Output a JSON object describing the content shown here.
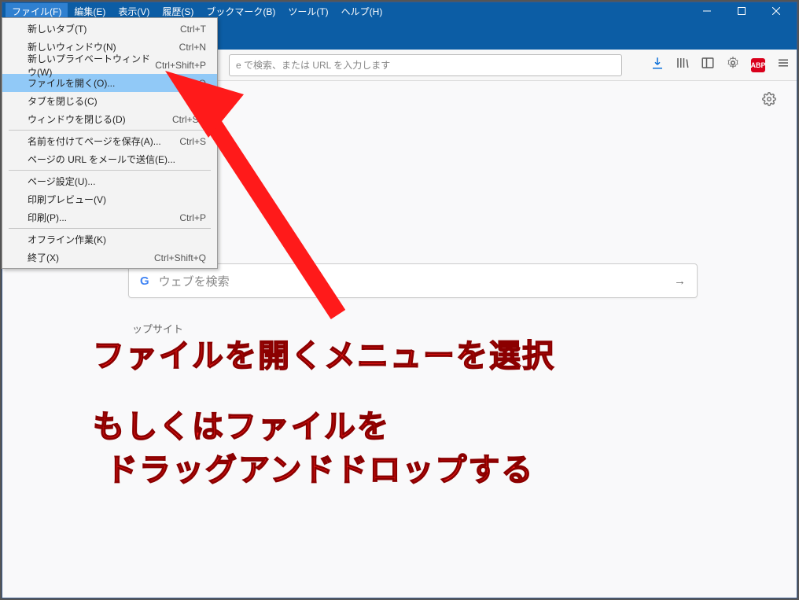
{
  "menubar": {
    "file": "ファイル(F)",
    "edit": "編集(E)",
    "view": "表示(V)",
    "history": "履歴(S)",
    "bookmarks": "ブックマーク(B)",
    "tools": "ツール(T)",
    "help": "ヘルプ(H)"
  },
  "urlbar_hint": "e で検索、または URL を入力します",
  "dropdown": {
    "new_tab": {
      "label": "新しいタブ(T)",
      "shortcut": "Ctrl+T"
    },
    "new_window": {
      "label": "新しいウィンドウ(N)",
      "shortcut": "Ctrl+N"
    },
    "new_private": {
      "label": "新しいプライベートウィンドウ(W)",
      "shortcut": "Ctrl+Shift+P"
    },
    "open_file": {
      "label": "ファイルを開く(O)...",
      "shortcut": "Ctrl+O"
    },
    "close_tab": {
      "label": "タブを閉じる(C)",
      "shortcut": ""
    },
    "close_window": {
      "label": "ウィンドウを閉じる(D)",
      "shortcut": "Ctrl+Shi"
    },
    "save_as": {
      "label": "名前を付けてページを保存(A)...",
      "shortcut": "Ctrl+S"
    },
    "email_link": {
      "label": "ページの URL をメールで送信(E)...",
      "shortcut": ""
    },
    "page_setup": {
      "label": "ページ設定(U)...",
      "shortcut": ""
    },
    "print_preview": {
      "label": "印刷プレビュー(V)",
      "shortcut": ""
    },
    "print": {
      "label": "印刷(P)...",
      "shortcut": "Ctrl+P"
    },
    "work_offline": {
      "label": "オフライン作業(K)",
      "shortcut": ""
    },
    "exit": {
      "label": "終了(X)",
      "shortcut": "Ctrl+Shift+Q"
    }
  },
  "search_placeholder": "ウェブを検索",
  "topsite_label": "ップサイト",
  "abp": "ABP",
  "annotations": {
    "line1": "ファイルを開くメニューを選択",
    "line2": "もしくはファイルを",
    "line3": "ドラッグアンドドロップする"
  }
}
